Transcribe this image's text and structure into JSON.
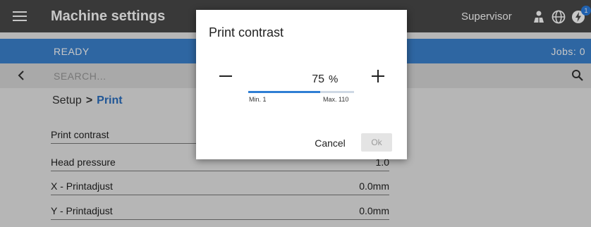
{
  "header": {
    "title": "Machine settings",
    "user": "Supervisor",
    "notification_count": "1",
    "icons": [
      "menu-icon",
      "user-icon",
      "globe-icon",
      "bolt-icon"
    ]
  },
  "status": {
    "state": "READY",
    "jobs": "Jobs: 0",
    "color": "#3c83d0"
  },
  "search": {
    "placeholder": "SEARCH..."
  },
  "breadcrumb": {
    "parent": "Setup",
    "separator": ">",
    "current": "Print"
  },
  "settings": [
    {
      "label": "Print contrast",
      "value": ""
    },
    {
      "label": "Head pressure",
      "value": "1.0"
    },
    {
      "label": "X - Printadjust",
      "value": "0.0mm"
    },
    {
      "label": "Y - Printadjust",
      "value": "0.0mm"
    }
  ],
  "dialog": {
    "title": "Print contrast",
    "value": "75",
    "unit": "%",
    "min_label": "Min. 1",
    "max_label": "Max. 110",
    "min": 1,
    "max": 110,
    "current": 75,
    "cancel_label": "Cancel",
    "ok_label": "Ok"
  },
  "colors": {
    "accent": "#2f7ed4",
    "header_bg": "#4a4a4a"
  }
}
